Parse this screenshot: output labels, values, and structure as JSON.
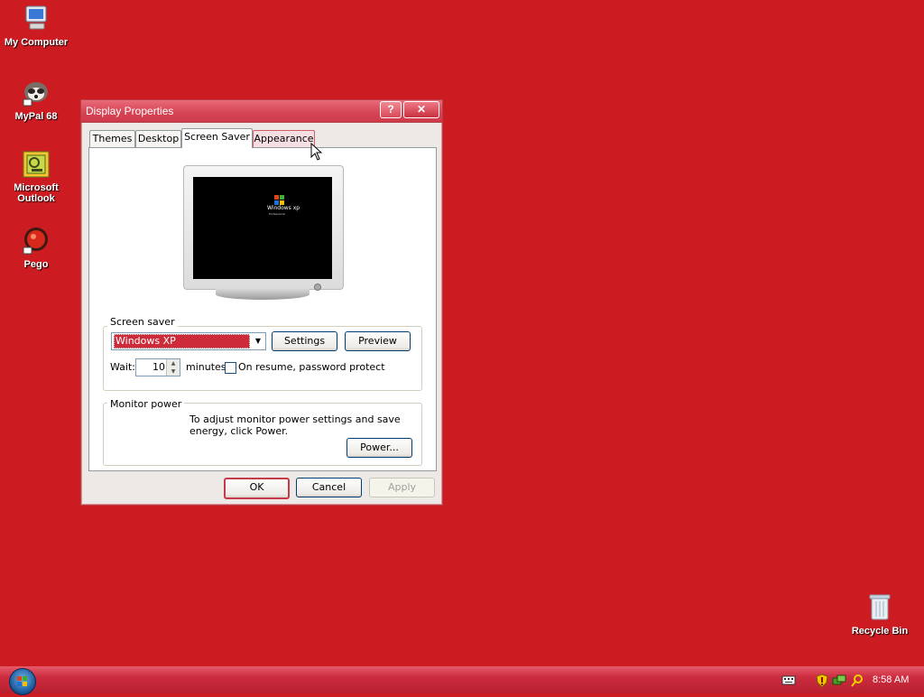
{
  "desktop": {
    "icons": [
      {
        "label": "My Computer",
        "icon": "my-computer-icon"
      },
      {
        "label": "MyPal 68",
        "icon": "mypal-raccoon-icon"
      },
      {
        "label": "Microsoft Outlook",
        "icon": "outlook-icon"
      },
      {
        "label": "Pego",
        "icon": "pego-icon"
      },
      {
        "label": "Recycle Bin",
        "icon": "recycle-bin-icon"
      }
    ],
    "background_color": "#cc1c22"
  },
  "dialog": {
    "title": "Display Properties",
    "help_button": "?",
    "close_button": "✕",
    "tabs": [
      {
        "label": "Themes",
        "active": false
      },
      {
        "label": "Desktop",
        "active": false
      },
      {
        "label": "Screen Saver",
        "active": true
      },
      {
        "label": "Appearance",
        "active": false,
        "hover": true
      }
    ],
    "preview": {
      "screen_text": "Windows xp",
      "screen_subtext": "Professional"
    },
    "screen_saver": {
      "group_label": "Screen saver",
      "selected": "Windows XP",
      "settings_label": "Settings",
      "preview_label": "Preview",
      "wait_label": "Wait:",
      "wait_value": "10",
      "minutes_label": "minutes",
      "resume_label": "On resume, password protect",
      "resume_checked": false
    },
    "monitor_power": {
      "group_label": "Monitor power",
      "text": "To adjust monitor power settings and save energy, click Power.",
      "power_label": "Power..."
    },
    "buttons": {
      "ok": "OK",
      "cancel": "Cancel",
      "apply": "Apply"
    }
  },
  "taskbar": {
    "time": "8:58 AM",
    "tray_icons": [
      "keyboard-icon",
      "security-shield-icon",
      "network-icon",
      "search-icon"
    ]
  }
}
